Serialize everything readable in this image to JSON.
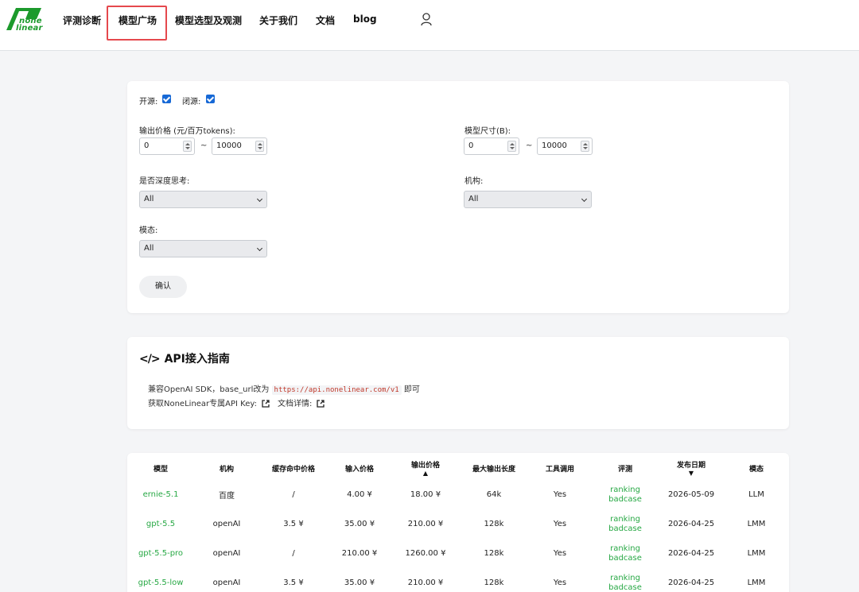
{
  "brand": {
    "line1": "none",
    "line2": "linear",
    "color": "#1c9a2c"
  },
  "nav": {
    "items": [
      "评测诊断",
      "模型广场",
      "模型选型及观测",
      "关于我们",
      "文档",
      "blog"
    ],
    "active": "模型广场"
  },
  "filters": {
    "open_source_label": "开源:",
    "open_source_checked": true,
    "closed_source_label": "闭源:",
    "closed_source_checked": true,
    "price_label": "输出价格 (元/百万tokens):",
    "price_min": "0",
    "price_max": "10000",
    "size_label": "模型尺寸(B):",
    "size_min": "0",
    "size_max": "10000",
    "range_sep": "~",
    "deep_think_label": "是否深度思考:",
    "deep_think_value": "All",
    "org_label": "机构:",
    "org_value": "All",
    "modality_label": "模态:",
    "modality_value": "All",
    "confirm_label": "确认"
  },
  "api_guide": {
    "icon": "</>",
    "title": "API接入指南",
    "line1_prefix": "兼容OpenAI SDK，base_url改为",
    "base_url": "https://api.nonelinear.com/v1",
    "line1_suffix": "即可",
    "key_label": "获取NoneLinear专属API Key:",
    "docs_label": "文档详情:"
  },
  "table": {
    "headers": [
      "模型",
      "机构",
      "缓存命中价格",
      "输入价格",
      "输出价格",
      "最大输出长度",
      "工具调用",
      "评测",
      "发布日期",
      "模态"
    ],
    "sort_up": "▲",
    "sort_down": "▼",
    "rows": [
      {
        "model": "ernie-5.1",
        "org": "百度",
        "cache": "/",
        "input": "4.00 ¥",
        "output": "18.00 ¥",
        "max_len": "64k",
        "tools": "Yes",
        "eval1": "ranking",
        "eval2": "badcase",
        "date": "2026-05-09",
        "modality": "LLM"
      },
      {
        "model": "gpt-5.5",
        "org": "openAI",
        "cache": "3.5 ¥",
        "input": "35.00 ¥",
        "output": "210.00 ¥",
        "max_len": "128k",
        "tools": "Yes",
        "eval1": "ranking",
        "eval2": "badcase",
        "date": "2026-04-25",
        "modality": "LMM"
      },
      {
        "model": "gpt-5.5-pro",
        "org": "openAI",
        "cache": "/",
        "input": "210.00 ¥",
        "output": "1260.00 ¥",
        "max_len": "128k",
        "tools": "Yes",
        "eval1": "ranking",
        "eval2": "badcase",
        "date": "2026-04-25",
        "modality": "LMM"
      },
      {
        "model": "gpt-5.5-low",
        "org": "openAI",
        "cache": "3.5 ¥",
        "input": "35.00 ¥",
        "output": "210.00 ¥",
        "max_len": "128k",
        "tools": "Yes",
        "eval1": "ranking",
        "eval2": "badcase",
        "date": "2026-04-25",
        "modality": "LMM"
      }
    ]
  },
  "colors": {
    "accent_green": "#27a844",
    "active_outline": "#e5484d",
    "checkbox_blue": "#1769d6",
    "code_red": "#c0392b"
  }
}
